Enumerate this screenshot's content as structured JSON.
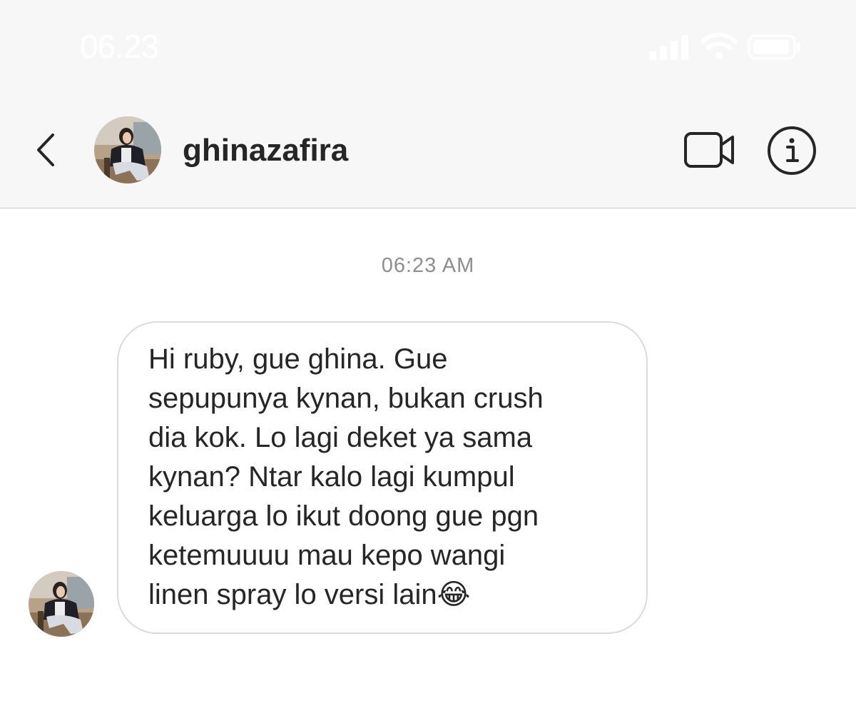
{
  "status_bar": {
    "time": "06.23",
    "icons": [
      "signal-icon",
      "wifi-icon",
      "battery-icon"
    ]
  },
  "header": {
    "back_icon": "chevron-left-icon",
    "username": "ghinazafira",
    "video_icon": "video-camera-icon",
    "info_icon": "info-icon"
  },
  "conversation": {
    "timestamp": "06:23 AM",
    "messages": [
      {
        "text": "Hi ruby, gue ghina. Gue\nsepupunya kynan, bukan crush\ndia kok. Lo lagi deket ya sama\nkynan? Ntar kalo lagi kumpul\nkeluarga lo ikut doong gue pgn\nketemuuuu mau kepo wangi\nlinen spray lo versi lain😂"
      }
    ]
  },
  "colors": {
    "header_background": "#f7f7f7",
    "header_border": "#c9c9c9",
    "text_primary": "#262626",
    "text_secondary": "#8e8e8e",
    "bubble_border": "#dbdbdb"
  }
}
